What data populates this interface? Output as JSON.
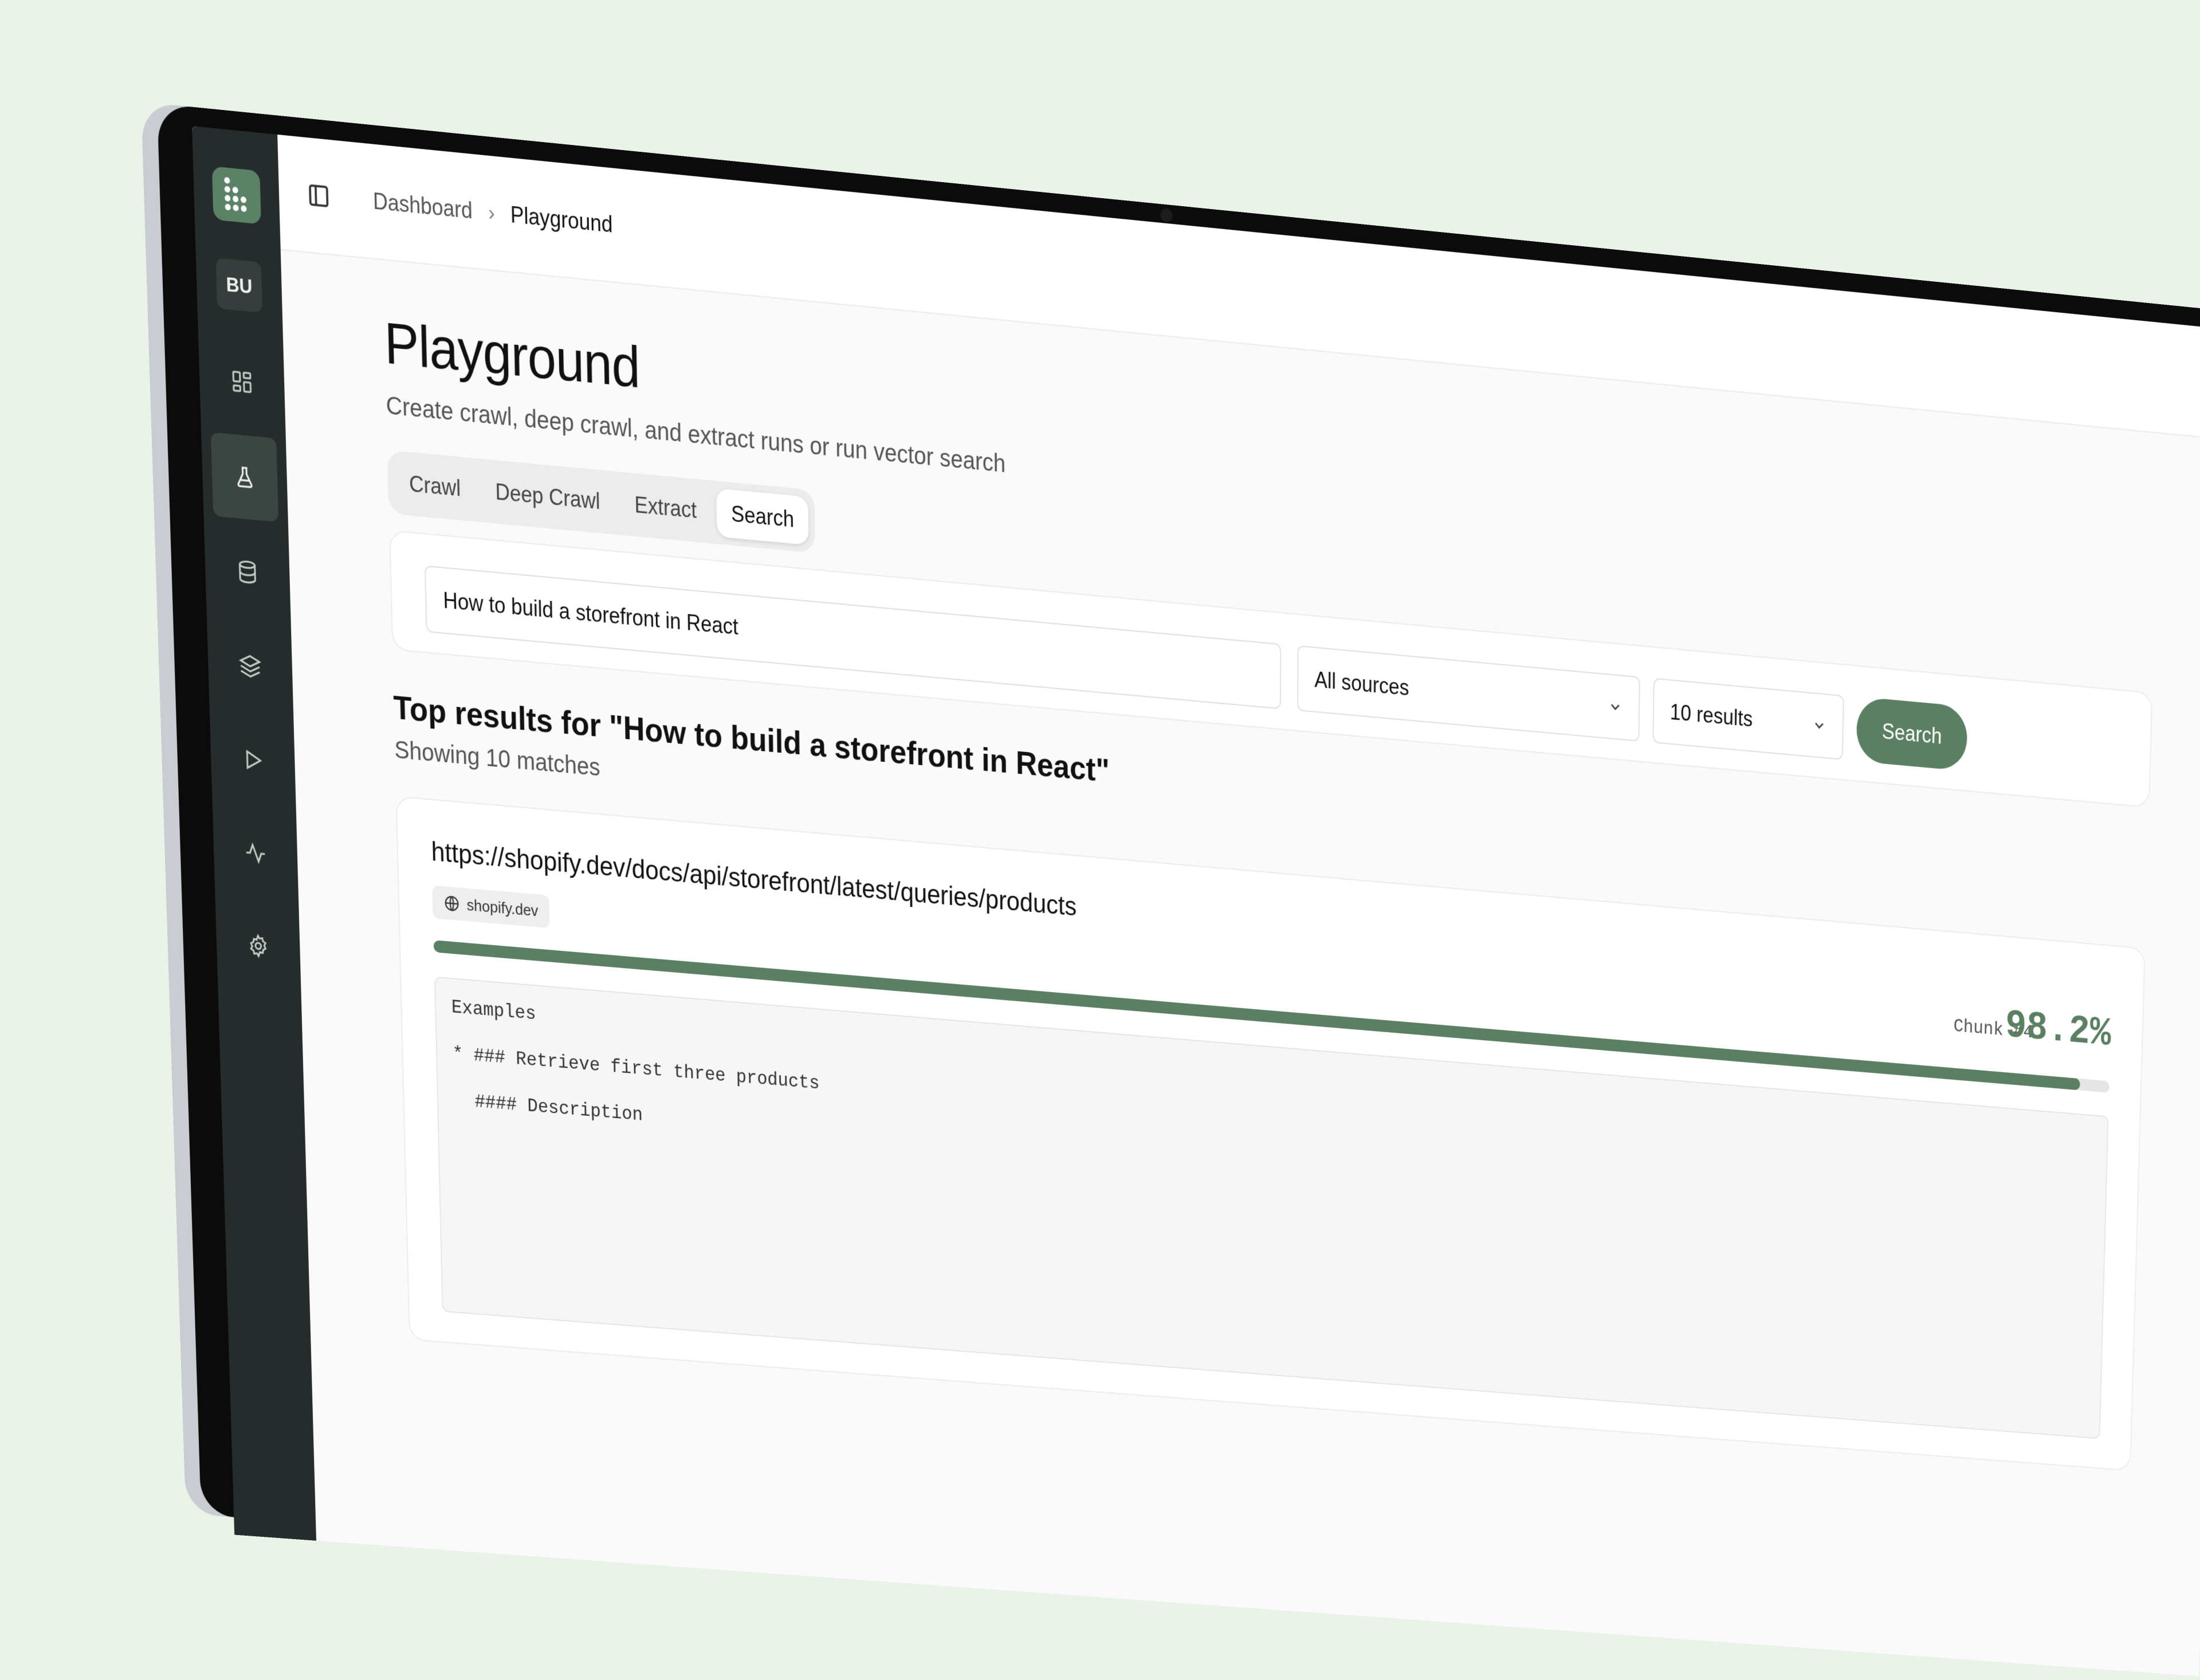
{
  "breadcrumb": {
    "parent": "Dashboard",
    "current": "Playground"
  },
  "user": {
    "initials": "BU"
  },
  "sidebar": {
    "items": [
      {
        "icon": "grid-icon",
        "active": false
      },
      {
        "icon": "flask-icon",
        "active": true
      },
      {
        "icon": "database-icon",
        "active": false
      },
      {
        "icon": "layers-icon",
        "active": false
      },
      {
        "icon": "play-icon",
        "active": false
      },
      {
        "icon": "activity-icon",
        "active": false
      },
      {
        "icon": "gear-icon",
        "active": false
      }
    ]
  },
  "page": {
    "title": "Playground",
    "subtitle": "Create crawl, deep crawl, and extract runs or run vector search"
  },
  "tabs": [
    {
      "label": "Crawl",
      "active": false
    },
    {
      "label": "Deep Crawl",
      "active": false
    },
    {
      "label": "Extract",
      "active": false
    },
    {
      "label": "Search",
      "active": true
    }
  ],
  "search": {
    "query": "How to build a storefront in React",
    "source": "All sources",
    "count": "10 results",
    "button": "Search"
  },
  "results": {
    "heading": "Top results for \"How to build a storefront in React\"",
    "subheading": "Showing 10 matches",
    "items": [
      {
        "url": "https://shopify.dev/docs/api/storefront/latest/queries/products",
        "domain": "shopify.dev",
        "chunk": "Chunk #4",
        "score": "98.2%",
        "score_fraction": 0.982,
        "snippet": [
          "Examples",
          "* ### Retrieve first three products",
          "  #### Description"
        ]
      }
    ]
  },
  "colors": {
    "accent": "#5a7f62",
    "sidebar": "#252c2b",
    "background": "#eaf3e8"
  }
}
